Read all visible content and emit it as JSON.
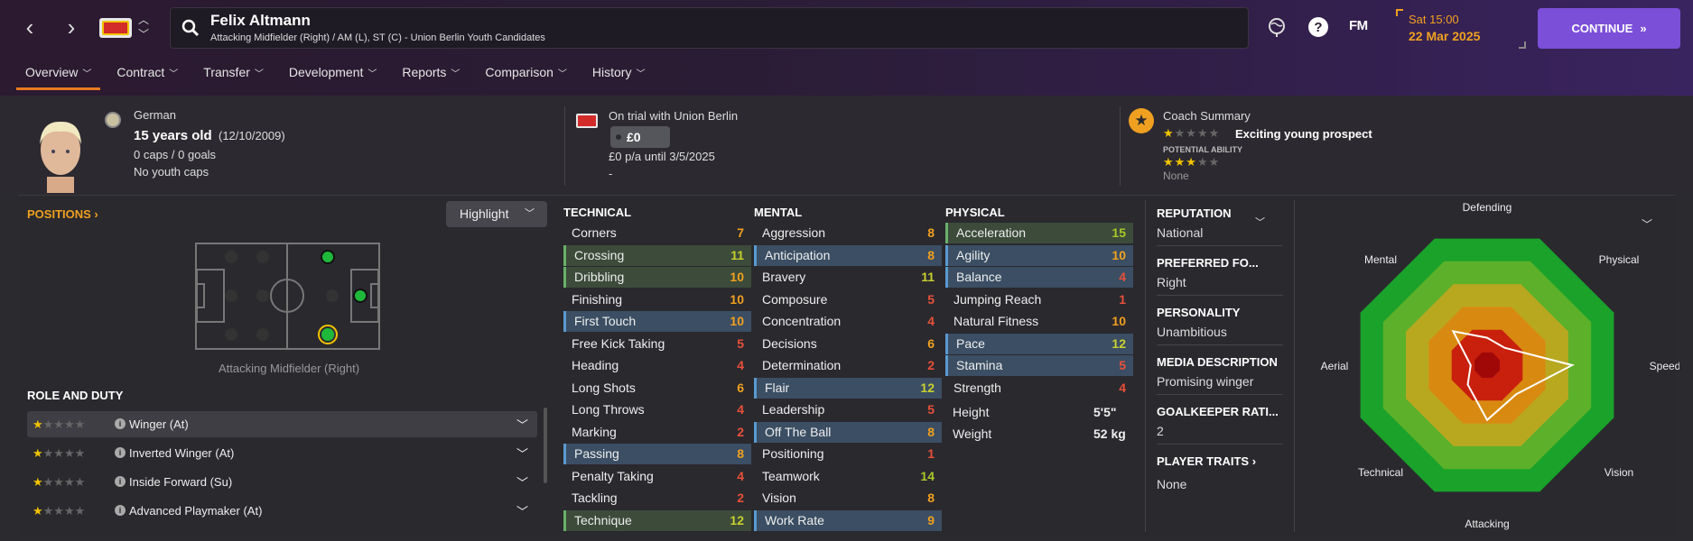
{
  "header": {
    "player_name": "Felix Altmann",
    "player_sub": "Attacking Midfielder (Right) / AM (L), ST (C) - Union Berlin Youth Candidates",
    "fm": "FM",
    "date_day": "Sat 15:00",
    "date_date": "22 Mar 2025",
    "continue_label": "CONTINUE"
  },
  "tabs": [
    {
      "label": "Overview"
    },
    {
      "label": "Contract"
    },
    {
      "label": "Transfer"
    },
    {
      "label": "Development"
    },
    {
      "label": "Reports"
    },
    {
      "label": "Comparison"
    },
    {
      "label": "History"
    }
  ],
  "profile": {
    "nationality": "German",
    "age": "15 years old",
    "dob": "(12/10/2009)",
    "caps": "0 caps / 0 goals",
    "youth_caps": "No youth caps"
  },
  "contract": {
    "status": "On trial with Union Berlin",
    "value": "£0",
    "wage": "£0 p/a until 3/5/2025",
    "extra": "-"
  },
  "coach": {
    "title": "Coach Summary",
    "summary": "Exciting young prospect",
    "current_stars": 1,
    "pa_label": "POTENTIAL ABILITY",
    "potential_stars": 3,
    "footnote": "None"
  },
  "positions": {
    "title": "POSITIONS",
    "highlight_label": "Highlight",
    "caption": "Attacking Midfielder (Right)"
  },
  "roles": {
    "title": "ROLE AND DUTY",
    "items": [
      {
        "name": "Winger (At)",
        "stars": 1
      },
      {
        "name": "Inverted Winger (At)",
        "stars": 1
      },
      {
        "name": "Inside Forward (Su)",
        "stars": 1
      },
      {
        "name": "Advanced Playmaker (At)",
        "stars": 1
      }
    ]
  },
  "technical": {
    "title": "TECHNICAL",
    "items": [
      {
        "name": "Corners",
        "value": "7"
      },
      {
        "name": "Crossing",
        "value": "11"
      },
      {
        "name": "Dribbling",
        "value": "10"
      },
      {
        "name": "Finishing",
        "value": "10"
      },
      {
        "name": "First Touch",
        "value": "10"
      },
      {
        "name": "Free Kick Taking",
        "value": "5"
      },
      {
        "name": "Heading",
        "value": "4"
      },
      {
        "name": "Long Shots",
        "value": "6"
      },
      {
        "name": "Long Throws",
        "value": "4"
      },
      {
        "name": "Marking",
        "value": "2"
      },
      {
        "name": "Passing",
        "value": "8"
      },
      {
        "name": "Penalty Taking",
        "value": "4"
      },
      {
        "name": "Tackling",
        "value": "2"
      },
      {
        "name": "Technique",
        "value": "12"
      }
    ]
  },
  "mental": {
    "title": "MENTAL",
    "items": [
      {
        "name": "Aggression",
        "value": "8"
      },
      {
        "name": "Anticipation",
        "value": "8"
      },
      {
        "name": "Bravery",
        "value": "11"
      },
      {
        "name": "Composure",
        "value": "5"
      },
      {
        "name": "Concentration",
        "value": "4"
      },
      {
        "name": "Decisions",
        "value": "6"
      },
      {
        "name": "Determination",
        "value": "2"
      },
      {
        "name": "Flair",
        "value": "12"
      },
      {
        "name": "Leadership",
        "value": "5"
      },
      {
        "name": "Off The Ball",
        "value": "8"
      },
      {
        "name": "Positioning",
        "value": "1"
      },
      {
        "name": "Teamwork",
        "value": "14"
      },
      {
        "name": "Vision",
        "value": "8"
      },
      {
        "name": "Work Rate",
        "value": "9"
      }
    ]
  },
  "physical": {
    "title": "PHYSICAL",
    "items": [
      {
        "name": "Acceleration",
        "value": "15"
      },
      {
        "name": "Agility",
        "value": "10"
      },
      {
        "name": "Balance",
        "value": "4"
      },
      {
        "name": "Jumping Reach",
        "value": "1"
      },
      {
        "name": "Natural Fitness",
        "value": "10"
      },
      {
        "name": "Pace",
        "value": "12"
      },
      {
        "name": "Stamina",
        "value": "5"
      },
      {
        "name": "Strength",
        "value": "4"
      }
    ],
    "height_label": "Height",
    "height": "5'5\"",
    "weight_label": "Weight",
    "weight": "52 kg"
  },
  "side": {
    "reputation_title": "REPUTATION",
    "reputation": "National",
    "foot_title": "PREFERRED FO...",
    "foot": "Right",
    "personality_title": "PERSONALITY",
    "personality": "Unambitious",
    "media_title": "MEDIA DESCRIPTION",
    "media": "Promising winger",
    "gk_title": "GOALKEEPER RATI...",
    "gk": "2",
    "traits_title": "PLAYER TRAITS",
    "traits": "None"
  },
  "radar": {
    "labels": [
      "Defending",
      "Physical",
      "Speed",
      "Vision",
      "Attacking",
      "Technical",
      "Aerial",
      "Mental"
    ],
    "values": [
      0.2,
      0.18,
      0.62,
      0.3,
      0.4,
      0.2,
      0.12,
      0.35
    ]
  },
  "colors": {
    "accent": "#f0a020",
    "continue": "#7b4fd8"
  }
}
